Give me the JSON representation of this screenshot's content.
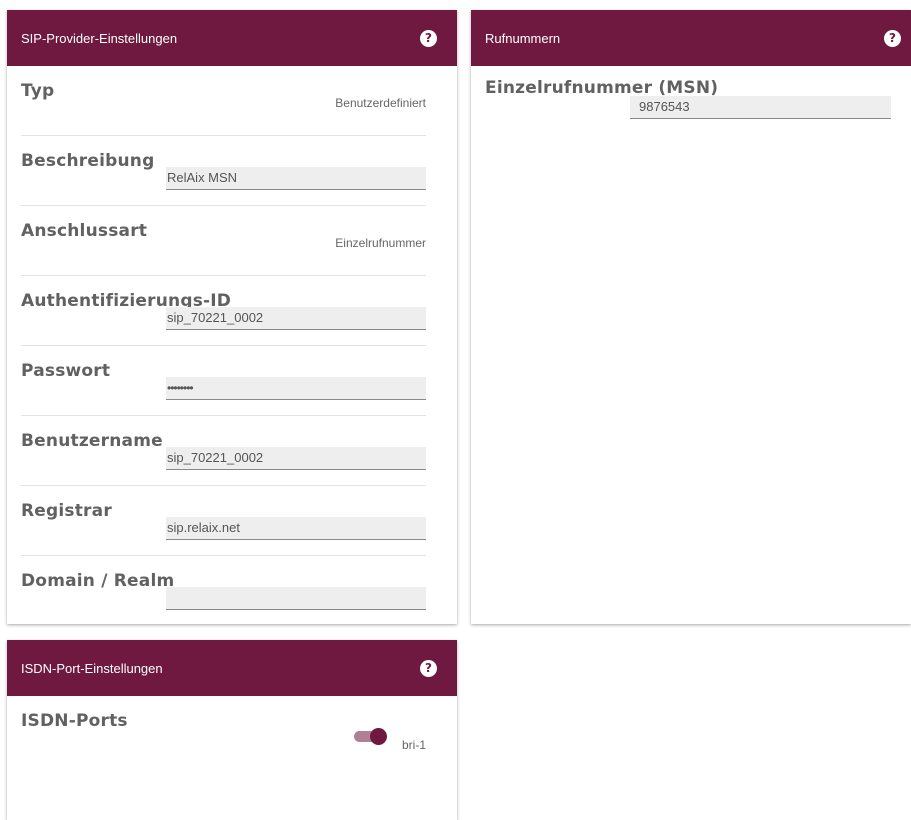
{
  "sip_panel": {
    "title": "SIP-Provider-Einstellungen",
    "help": "?",
    "rows": [
      {
        "label": "Typ",
        "value": "Benutzerdefiniert"
      },
      {
        "label": "Beschreibung",
        "value": "RelAix MSN"
      },
      {
        "label": "Anschlussart",
        "value": "Einzelrufnummer"
      },
      {
        "label": "Authentifizierungs-ID",
        "value": "sip_70221_0002"
      },
      {
        "label": "Passwort",
        "value": "••••••••"
      },
      {
        "label": "Benutzername",
        "value": "sip_70221_0002"
      },
      {
        "label": "Registrar",
        "value": "sip.relaix.net"
      },
      {
        "label": "Domain / Realm",
        "value": ""
      }
    ]
  },
  "rufnummern_panel": {
    "title": "Rufnummern",
    "help": "?",
    "msn_label": "Einzelrufnummer (MSN)",
    "msn_value": "9876543"
  },
  "isdn_panel": {
    "title": "ISDN-Port-Einstellungen",
    "help": "?",
    "ports_label": "ISDN-Ports",
    "port_name": "bri-1",
    "port_enabled": true
  },
  "colors": {
    "header": "#6f1840",
    "toggle_track": "#b07e95"
  }
}
